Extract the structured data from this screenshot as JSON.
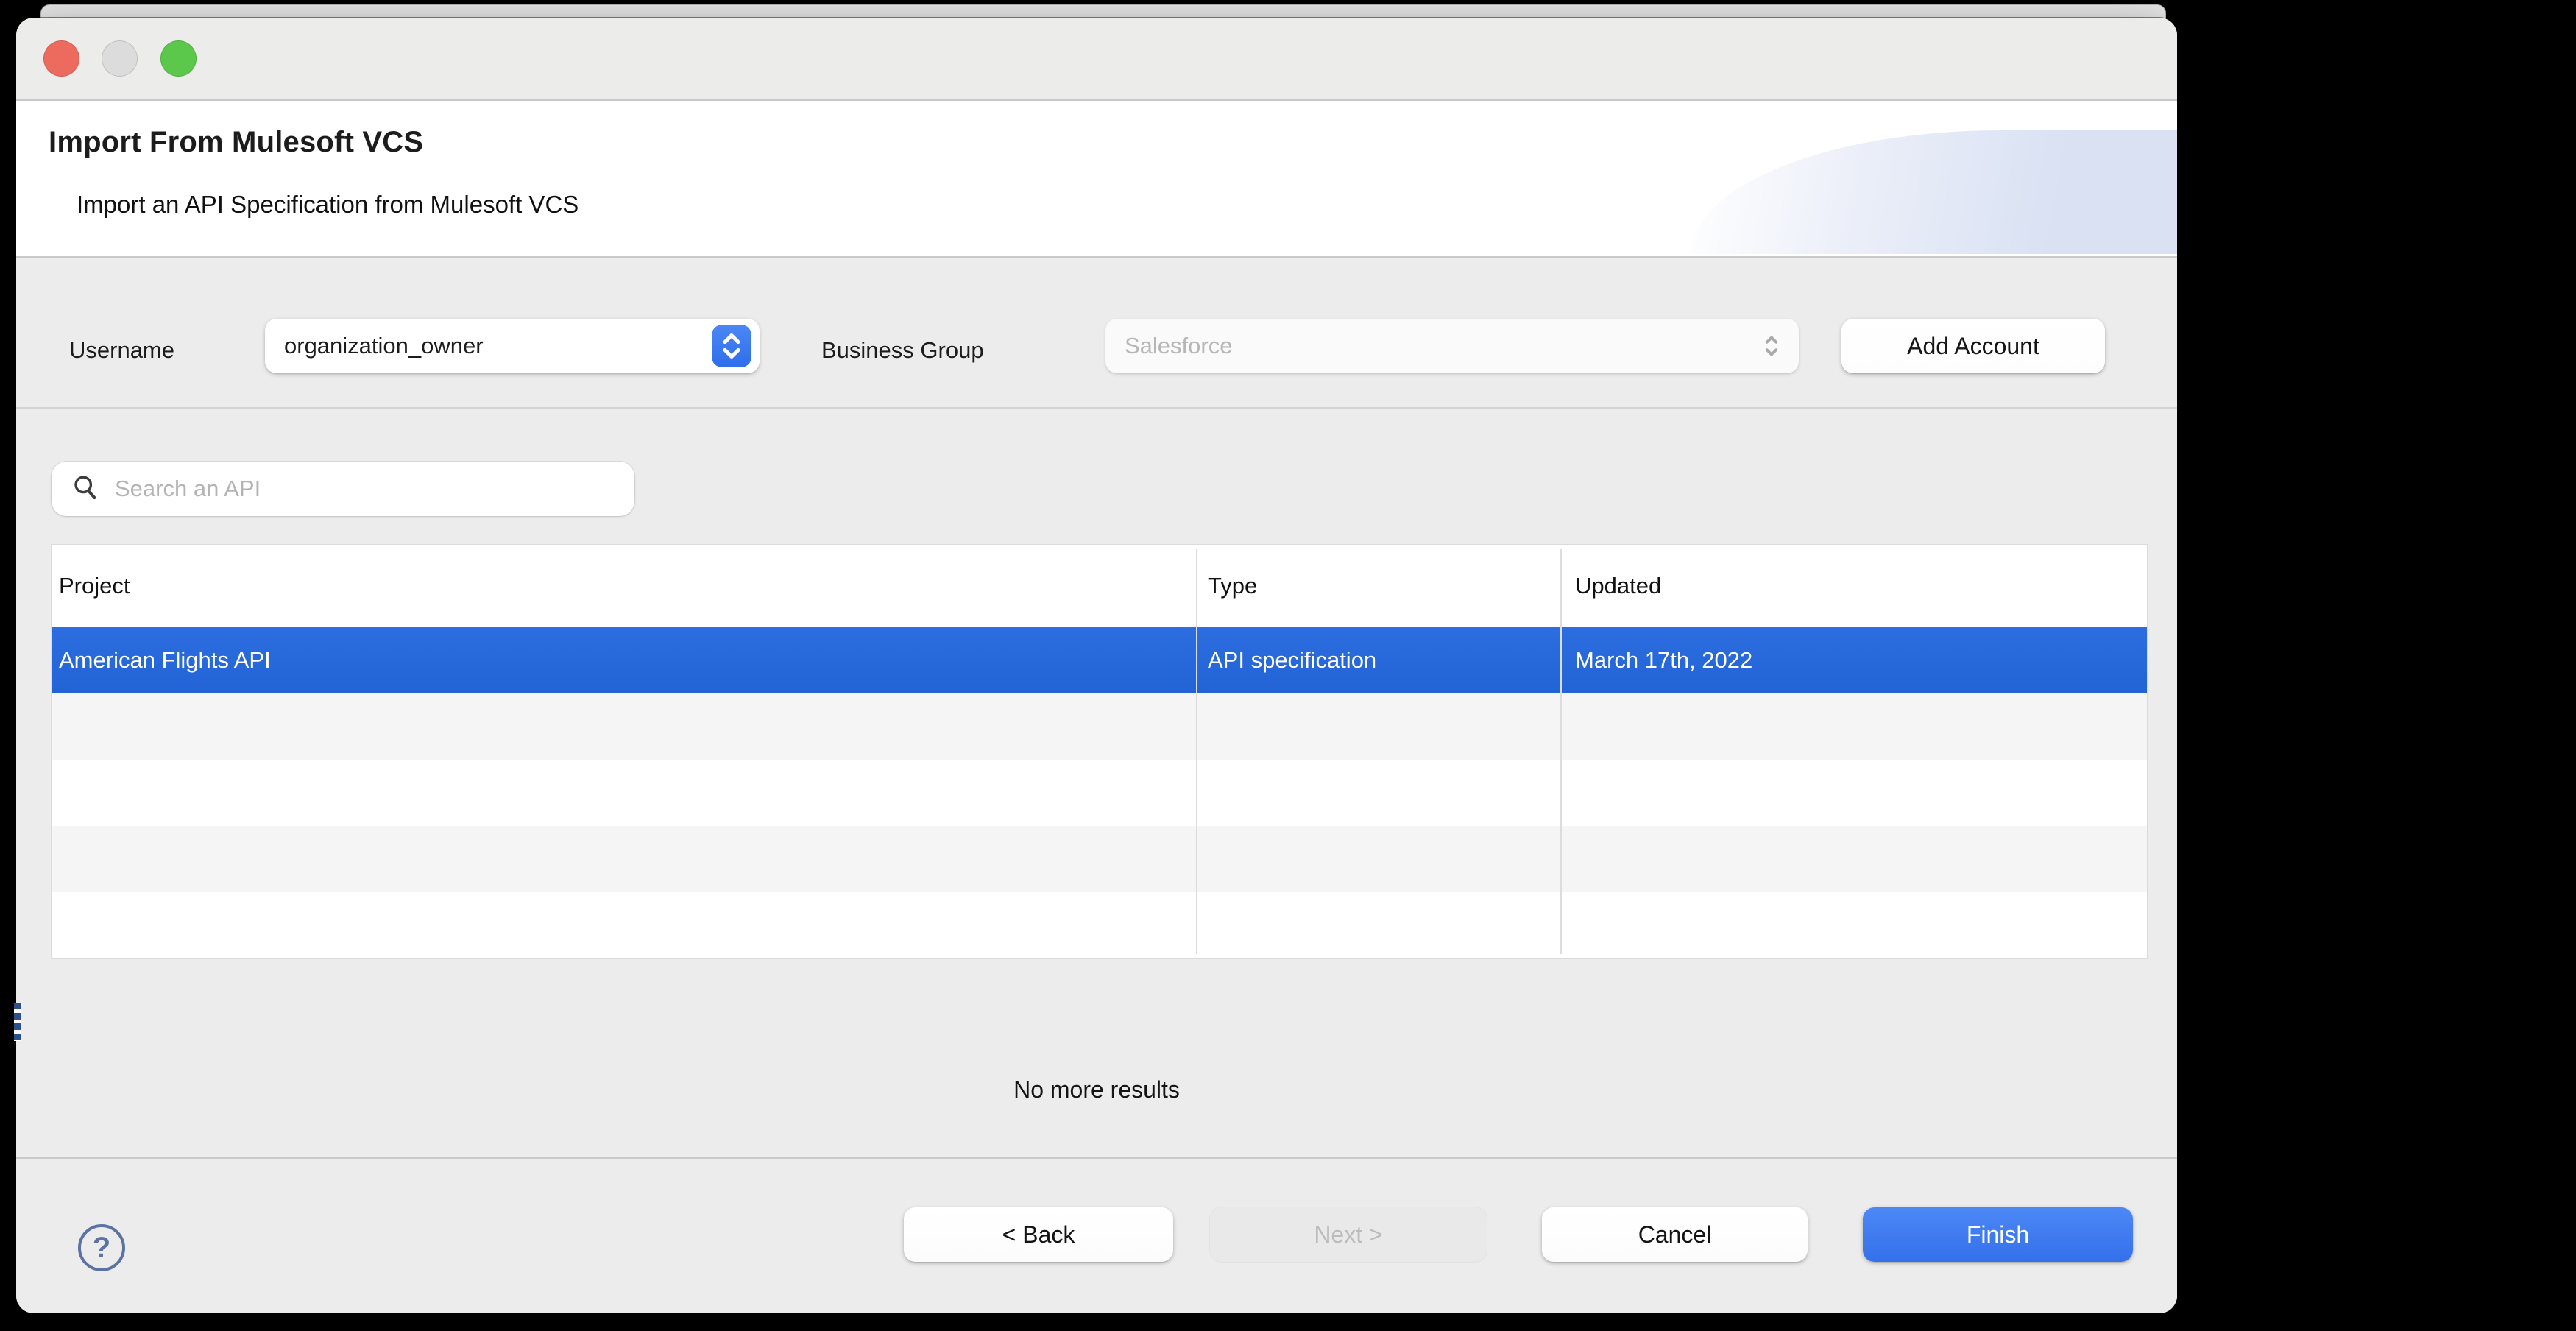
{
  "window": {
    "traffic_lights": {
      "close_color": "#ed6a5e",
      "minimize_color": "#dcdcdc",
      "zoom_color": "#5bc84c"
    },
    "header": {
      "title": "Import From Mulesoft VCS",
      "subtitle": "Import an API Specification from Mulesoft VCS"
    },
    "account_row": {
      "username_label": "Username",
      "username_value": "organization_owner",
      "business_group_label": "Business Group",
      "business_group_value": "Salesforce",
      "business_group_disabled": true,
      "add_account_label": "Add Account"
    },
    "search": {
      "placeholder": "Search an API",
      "value": ""
    },
    "table": {
      "columns": [
        "Project",
        "Type",
        "Updated"
      ],
      "rows": [
        {
          "project": "American Flights API",
          "type": "API specification",
          "updated": "March 17th, 2022",
          "selected": true
        }
      ],
      "empty_row_count": 4
    },
    "status_text": "No more results",
    "footer": {
      "help_label": "?",
      "back_label": "< Back",
      "next_label": "Next >",
      "next_disabled": true,
      "cancel_label": "Cancel",
      "finish_label": "Finish"
    },
    "colors": {
      "accent_blue": "#3b7cf7",
      "selection_blue": "#2667db",
      "finish_blue": "#4c88f5",
      "dialog_gray": "#ececec",
      "help_blue_gray": "#5c72a2"
    }
  }
}
